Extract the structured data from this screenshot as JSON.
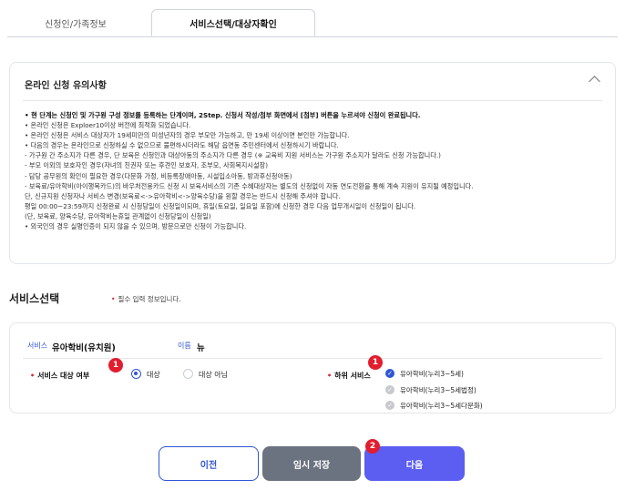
{
  "tabs": [
    {
      "label": "신청인/가족정보"
    },
    {
      "label": "서비스선택/대상자확인"
    }
  ],
  "notice": {
    "title": "온라인 신청 유의사항",
    "lines": [
      "• 현 단계는 신청인 및 가구원 구성 정보를 등록하는 단계이며, 2Step. 신청서 작성/첨부 화면에서 [첨부] 버튼을 누르셔야 신청이 완료됩니다.",
      "• 온라인 신청은 Exploer10이상 버전에 최적화 되었습니다.",
      "• 온라인 신청은 서비스 대상자가 19세미만의 미성년자의 경우 부모만 가능하고, 만 19세 이상이면 본인만 가능합니다.",
      "• 다음의 경우는 온라인으로 신청하실 수 없으므로 불편하시더라도 해당 읍면동 주민센터에서 신청하시기 바랍니다.",
      "  - 가구원 간 주소지가 다른 경우, 단 보육은 신청인과 대상아동의 주소지가 다른 경우 (※ 교육비 지원 서비스는 가구원 주소지가 달라도 신청 가능합니다.)",
      "  - 부모 이외의 보호자인 경우(자녀의 친권자 또는 후견인 보호자, 조부모, 사회복지시설장)",
      "  - 담당 공무원의 확인이 필요한 경우(다문화 가정, 비등록장애아동, 시설입소아동, 방과후신청아동)",
      "  - 보육료/유아학비(아이행복카드)의 바우처전용카드 신청 시 보육서비스의 기존 수혜대상자는 별도의 신청없이 자동 연도전환을 통해 계속 지원이 유지될 예정입니다.",
      "    단, 신규지원 신청자나 서비스 변경(보육료<->유아학비<->양육수당)을 원할 경우는 반드시 신청해 주셔야 합니다.",
      "  평일 00:00~23:59까지 신청완료 시 신청당일이 신청일이되며, 휴일(토요일, 일요일 포함)에 신청한 경우 다음 업무개시일이 신청일이 됩니다.",
      "  (단, 보육료, 양육수당, 유아학비는휴일 관계없이 신청당일이 신청일)",
      "• 외국인의 경우 실명인증이 되지 않을 수 있으며, 방문으로만 신청이 가능합니다."
    ]
  },
  "service_section": {
    "title": "서비스선택",
    "required_note": "필수 입력 정보입니다.",
    "service_label": "서비스",
    "service_value": "유아학비(유치원)",
    "name_label": "이름",
    "name_value": "뉴",
    "target_label": "서비스 대상 여부",
    "radio_options": [
      {
        "label": "대상",
        "selected": true
      },
      {
        "label": "대상 아님",
        "selected": false
      }
    ],
    "sub_label": "하위 서비스",
    "sub_options": [
      {
        "label": "유아학비(누리3~5세)",
        "checked": true
      },
      {
        "label": "유아학비(누리3~5세법정)",
        "checked": false
      },
      {
        "label": "유아학비(누리3~5세다문화)",
        "checked": false
      }
    ]
  },
  "badges": [
    "1",
    "1",
    "2"
  ],
  "buttons": {
    "prev": "이전",
    "save": "임시 저장",
    "next": "다음"
  },
  "colors": {
    "accent": "#2f55d4",
    "badge": "#e11d2e",
    "next_button": "#5b5ef0",
    "save_button": "#6b7280"
  }
}
